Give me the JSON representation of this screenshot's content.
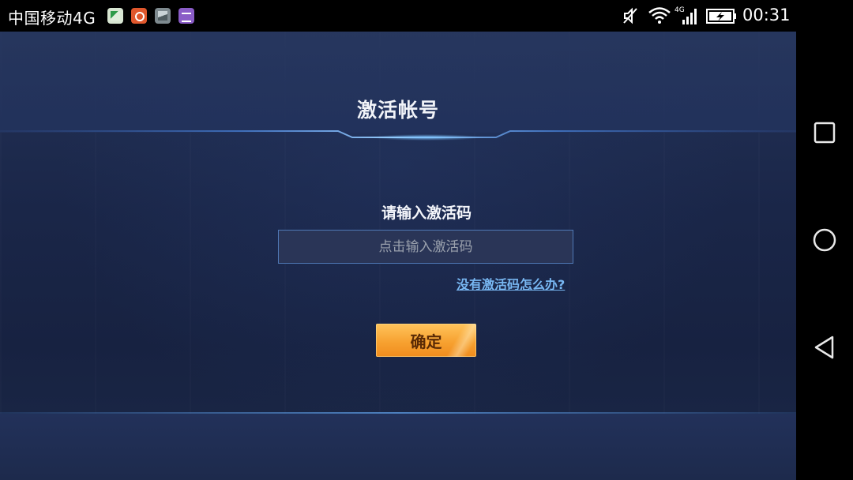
{
  "status_bar": {
    "carrier": "中国移动4G",
    "network_badge": "4G",
    "time": "00:31",
    "notification_icons": [
      "app-notification-icon",
      "app-notification-icon",
      "gallery-notification-icon",
      "app-notification-icon"
    ],
    "system_icons": [
      "mute-icon",
      "wifi-icon",
      "signal-icon",
      "battery-charging-icon"
    ]
  },
  "dialog": {
    "title": "激活帐号",
    "label": "请输入激活码",
    "input_placeholder": "点击输入激活码",
    "input_value": "",
    "help_link": "没有激活码怎么办?",
    "confirm_button": "确定"
  },
  "nav_bar": {
    "buttons": [
      "recents-icon",
      "home-icon",
      "back-icon"
    ]
  },
  "colors": {
    "accent_blue": "#78b7f2",
    "button_orange": "#f7a231",
    "background_navy": "#1a2648"
  }
}
